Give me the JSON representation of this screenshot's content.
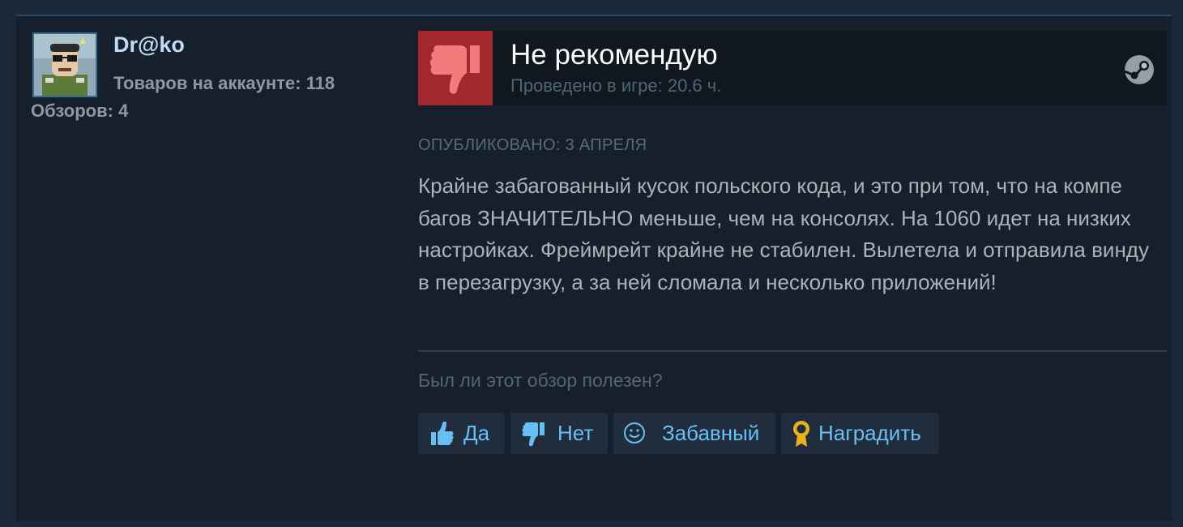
{
  "author": {
    "name": "Dr@ko",
    "owned_label": "Товаров на аккаунте: 118",
    "reviews_label": "Обзоров: 4",
    "avatar_icon": "avatar-portrait"
  },
  "review": {
    "verdict": "Не рекомендую",
    "verdict_icon": "thumbs-down-icon",
    "hours": "Проведено в игре: 20.6 ч.",
    "platform_icon": "steam-icon",
    "posted": "ОПУБЛИКОВАНО: 3 АПРЕЛЯ",
    "text": "Крайне забагованный кусок польского кода, и это при том, что на компе багов ЗНАЧИТЕЛЬНО меньше, чем на консолях. На 1060 идет на низких настройках. Фреймрейт крайне не стабилен. Вылетела и отправила винду в перезагрузку, а за ней сломала и несколько приложений!"
  },
  "feedback": {
    "question": "Был ли этот обзор полезен?",
    "yes_label": "Да",
    "no_label": "Нет",
    "funny_label": "Забавный",
    "award_label": "Наградить"
  },
  "colors": {
    "background": "#1b2838",
    "card": "#16202d",
    "not_recommended": "#a3282d",
    "link_blue": "#66c0f4",
    "award_gold": "#e8b317"
  }
}
